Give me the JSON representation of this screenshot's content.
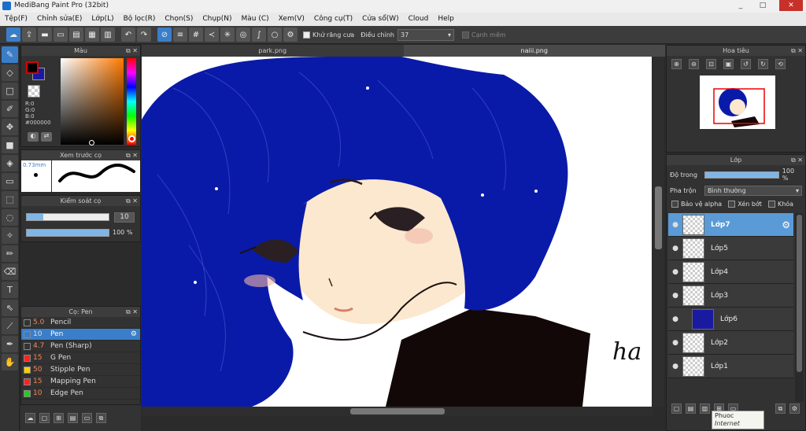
{
  "window": {
    "title": "MediBang Paint Pro (32bit)",
    "minimize": "_",
    "maximize": "□",
    "close": "✕"
  },
  "menu": [
    "Tệp(F)",
    "Chỉnh sửa(E)",
    "Lớp(L)",
    "Bộ lọc(R)",
    "Chọn(S)",
    "Chụp(N)",
    "Màu (C)",
    "Xem(V)",
    "Công cụ(T)",
    "Cửa sổ(W)",
    "Cloud",
    "Help"
  ],
  "toolbar": {
    "antialias_label": "Khử răng cưa",
    "correction_label": "Điều chỉnh",
    "correction_value": "37",
    "edge_label": "Cạnh mềm"
  },
  "color_panel": {
    "title": "Màu",
    "readout": [
      "R:0",
      "G:0",
      "B:0",
      "#000000"
    ],
    "fg": "#000000",
    "bg": "#1a1aa0"
  },
  "preview_panel": {
    "title": "Xem trước cọ",
    "size": "0.73mm"
  },
  "stabilizer_panel": {
    "title": "Kiểm soát cọ",
    "value": "10",
    "opacity": "100 %",
    "value_fraction": 0.2,
    "opacity_fraction": 1.0
  },
  "brush_panel": {
    "title": "Cọ: Pen",
    "brushes": [
      {
        "size": "5.0",
        "name": "Pencil",
        "color": "#333333"
      },
      {
        "size": "10",
        "name": "Pen",
        "color": "#3a7ec9",
        "selected": true
      },
      {
        "size": "4.7",
        "name": "Pen (Sharp)",
        "color": "#333333"
      },
      {
        "size": "15",
        "name": "G Pen",
        "color": "#ff2222"
      },
      {
        "size": "50",
        "name": "Stipple Pen",
        "color": "#ffcc00"
      },
      {
        "size": "15",
        "name": "Mapping Pen",
        "color": "#ff2222"
      },
      {
        "size": "10",
        "name": "Edge Pen",
        "color": "#22cc22"
      }
    ]
  },
  "tabs": [
    "park.png",
    "naiii.png"
  ],
  "canvas": {
    "signature": "ha"
  },
  "navigator": {
    "title": "Hoa tiêu"
  },
  "layer_panel": {
    "title": "Lớp",
    "opacity_label": "Độ trong",
    "opacity_value": "100 %",
    "opacity_fraction": 1.0,
    "blend_label": "Pha trộn",
    "blend_value": "Bình thường",
    "protect_alpha": "Bảo vệ alpha",
    "clipping": "Xén bớt",
    "lock": "Khóa",
    "layers": [
      {
        "name": "Lớp7",
        "selected": true
      },
      {
        "name": "Lớp5"
      },
      {
        "name": "Lớp4"
      },
      {
        "name": "Lớp3"
      },
      {
        "name": "Lớp6",
        "thumb": "#1a1aa0"
      },
      {
        "name": "Lớp2"
      },
      {
        "name": "Lớp1"
      }
    ]
  },
  "tooltip": {
    "title": "Phuoc",
    "subtitle": "Internet access"
  }
}
